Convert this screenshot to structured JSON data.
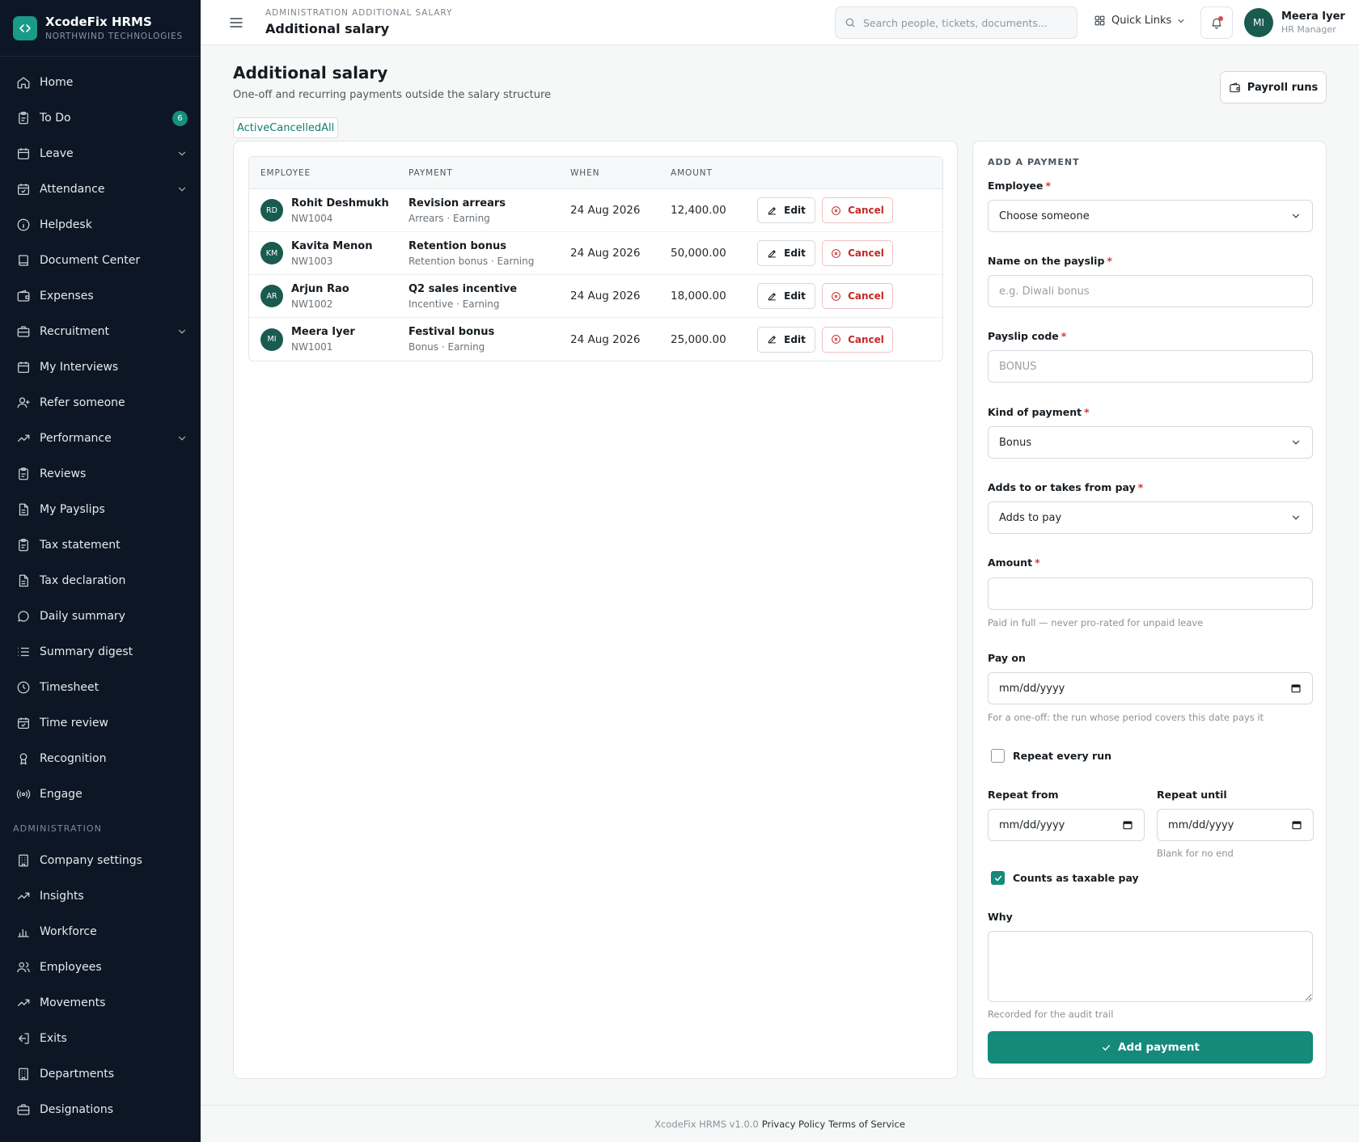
{
  "brand": {
    "name": "XcodeFix HRMS",
    "org": "NORTHWIND TECHNOLOGIES"
  },
  "sidebar": {
    "items": [
      {
        "label": "Home",
        "icon": "home-icon"
      },
      {
        "label": "To Do",
        "icon": "clipboard-icon",
        "badge": "6"
      },
      {
        "label": "Leave",
        "icon": "calendar-icon",
        "expandable": true
      },
      {
        "label": "Attendance",
        "icon": "calendar-check-icon",
        "expandable": true
      },
      {
        "label": "Helpdesk",
        "icon": "info-icon"
      },
      {
        "label": "Document Center",
        "icon": "book-icon"
      },
      {
        "label": "Expenses",
        "icon": "wallet-icon"
      },
      {
        "label": "Recruitment",
        "icon": "briefcase-icon",
        "expandable": true
      },
      {
        "label": "My Interviews",
        "icon": "calendar-icon"
      },
      {
        "label": "Refer someone",
        "icon": "user-plus-icon"
      },
      {
        "label": "Performance",
        "icon": "trending-up-icon",
        "expandable": true
      },
      {
        "label": "Reviews",
        "icon": "clipboard-icon"
      },
      {
        "label": "My Payslips",
        "icon": "file-icon"
      },
      {
        "label": "Tax statement",
        "icon": "clipboard-icon"
      },
      {
        "label": "Tax declaration",
        "icon": "file-icon"
      },
      {
        "label": "Daily summary",
        "icon": "message-icon"
      },
      {
        "label": "Summary digest",
        "icon": "list-icon"
      },
      {
        "label": "Timesheet",
        "icon": "clock-icon"
      },
      {
        "label": "Time review",
        "icon": "calendar-check-icon"
      },
      {
        "label": "Recognition",
        "icon": "award-icon"
      },
      {
        "label": "Engage",
        "icon": "radio-icon"
      }
    ],
    "admin_section": "ADMINISTRATION",
    "admin_items": [
      {
        "label": "Company settings",
        "icon": "building-icon"
      },
      {
        "label": "Insights",
        "icon": "trending-up-icon"
      },
      {
        "label": "Workforce",
        "icon": "bar-chart-icon"
      },
      {
        "label": "Employees",
        "icon": "users-icon"
      },
      {
        "label": "Movements",
        "icon": "trending-up-icon"
      },
      {
        "label": "Exits",
        "icon": "log-out-icon"
      },
      {
        "label": "Departments",
        "icon": "building-icon"
      },
      {
        "label": "Designations",
        "icon": "briefcase-icon"
      }
    ]
  },
  "header": {
    "breadcrumb": "ADMINISTRATION ADDITIONAL SALARY",
    "title": "Additional salary",
    "search_placeholder": "Search people, tickets, documents...",
    "quick_links": "Quick Links",
    "user": {
      "name": "Meera Iyer",
      "role": "HR Manager",
      "initials": "MI"
    }
  },
  "page": {
    "title": "Additional salary",
    "subtitle": "One-off and recurring payments outside the salary structure",
    "payroll_runs": "Payroll runs",
    "filters": [
      "Active",
      "Cancelled",
      "All"
    ]
  },
  "table": {
    "columns": [
      "EMPLOYEE",
      "PAYMENT",
      "WHEN",
      "AMOUNT"
    ],
    "edit_label": "Edit",
    "cancel_label": "Cancel",
    "rows": [
      {
        "initials": "RD",
        "name": "Rohit Deshmukh",
        "id": "NW1004",
        "payment": "Revision arrears",
        "meta": "Arrears · Earning",
        "when": "24 Aug 2026",
        "amount": "12,400.00"
      },
      {
        "initials": "KM",
        "name": "Kavita Menon",
        "id": "NW1003",
        "payment": "Retention bonus",
        "meta": "Retention bonus · Earning",
        "when": "24 Aug 2026",
        "amount": "50,000.00"
      },
      {
        "initials": "AR",
        "name": "Arjun Rao",
        "id": "NW1002",
        "payment": "Q2 sales incentive",
        "meta": "Incentive · Earning",
        "when": "24 Aug 2026",
        "amount": "18,000.00"
      },
      {
        "initials": "MI",
        "name": "Meera Iyer",
        "id": "NW1001",
        "payment": "Festival bonus",
        "meta": "Bonus · Earning",
        "when": "24 Aug 2026",
        "amount": "25,000.00"
      }
    ]
  },
  "form": {
    "title": "ADD A PAYMENT",
    "employee_label": "Employee",
    "employee_value": "Choose someone",
    "payslip_name_label": "Name on the payslip",
    "payslip_name_placeholder": "e.g. Diwali bonus",
    "payslip_code_label": "Payslip code",
    "payslip_code_placeholder": "BONUS",
    "kind_label": "Kind of payment",
    "kind_value": "Bonus",
    "adds_label": "Adds to or takes from pay",
    "adds_value": "Adds to pay",
    "amount_label": "Amount",
    "amount_value": "",
    "amount_help": "Paid in full — never pro-rated for unpaid leave",
    "pay_on_label": "Pay on",
    "pay_on_value": "mm/dd/yyyy",
    "pay_on_help": "For a one-off: the run whose period covers this date pays it",
    "repeat_label": "Repeat every run",
    "repeat_checked": false,
    "repeat_from_label": "Repeat from",
    "repeat_from_value": "mm/dd/yyyy",
    "repeat_until_label": "Repeat until",
    "repeat_until_value": "mm/dd/yyyy",
    "repeat_until_help": "Blank for no end",
    "taxable_label": "Counts as taxable pay",
    "taxable_checked": true,
    "why_label": "Why",
    "why_help": "Recorded for the audit trail",
    "submit_label": "Add payment",
    "required_mark": "*"
  },
  "footer": {
    "version": "XcodeFix HRMS v1.0.0",
    "privacy": "Privacy Policy",
    "terms": "Terms of Service"
  },
  "colors": {
    "accent": "#15897a",
    "sidebar_bg": "#0c1624",
    "danger": "#c52929",
    "avatar": "#195b4f"
  }
}
